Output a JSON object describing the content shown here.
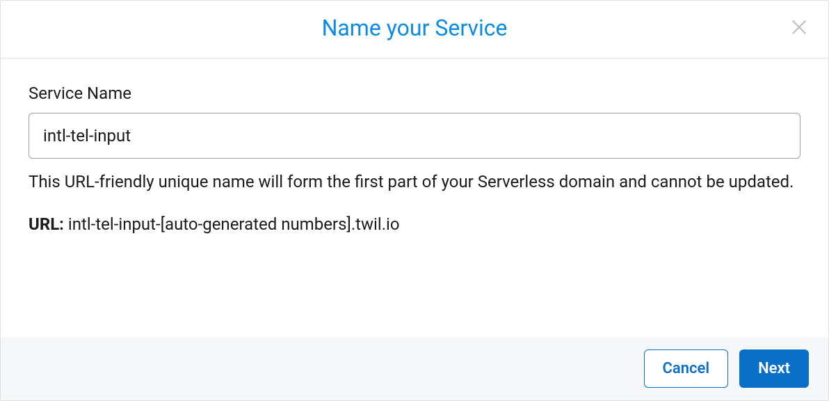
{
  "modal": {
    "title": "Name your Service",
    "close_icon": "close-icon"
  },
  "form": {
    "service_name_label": "Service Name",
    "service_name_value": "intl-tel-input",
    "help_text": "This URL-friendly unique name will form the first part of your Serverless domain and cannot be updated.",
    "url_label": "URL:",
    "url_value": "intl-tel-input-[auto-generated numbers].twil.io"
  },
  "footer": {
    "cancel_label": "Cancel",
    "next_label": "Next"
  }
}
